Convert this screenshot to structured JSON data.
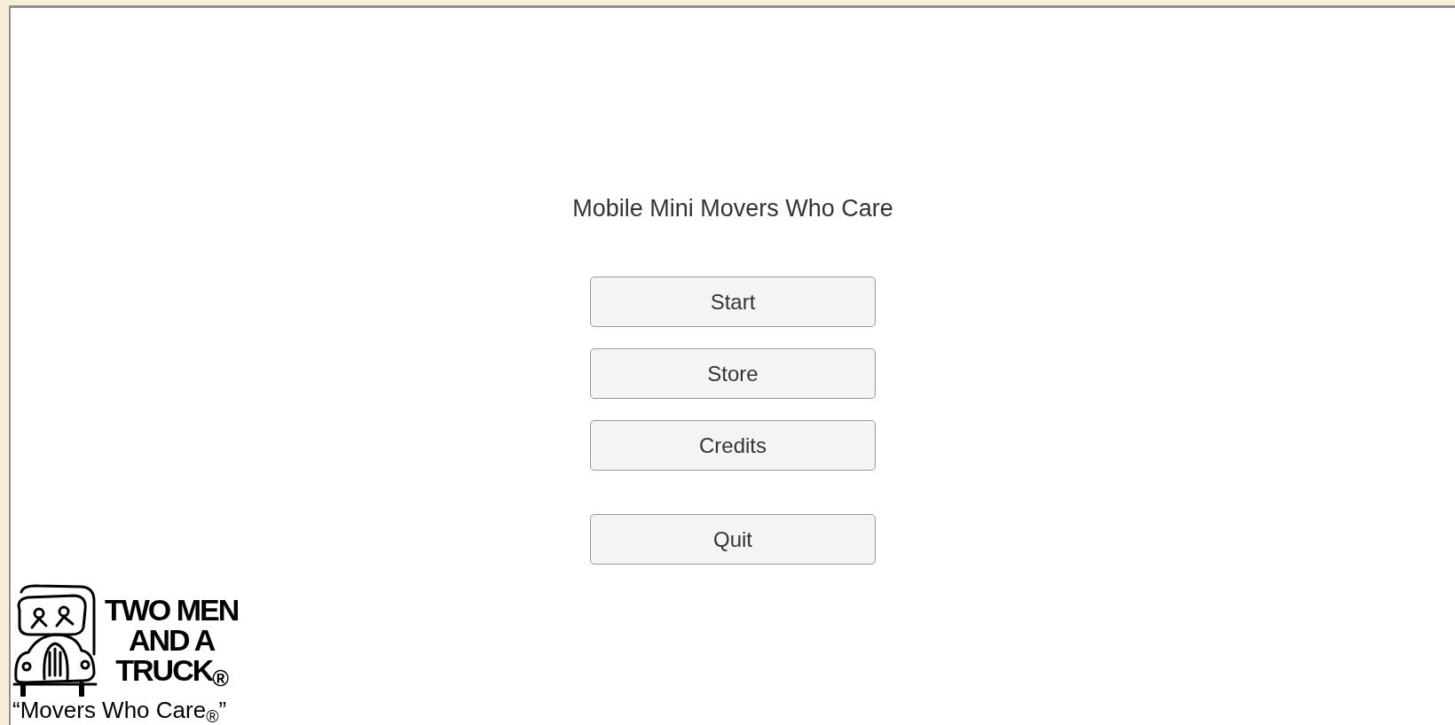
{
  "title": "Mobile Mini Movers Who Care",
  "button_groups": [
    [
      "Start",
      "Store",
      "Credits"
    ],
    [
      "Quit"
    ]
  ],
  "logo": {
    "lines": [
      "TWO MEN",
      "AND A",
      "TRUCK$_{®}$"
    ],
    "tagline": "“Movers Who Care$_{®}$”"
  }
}
